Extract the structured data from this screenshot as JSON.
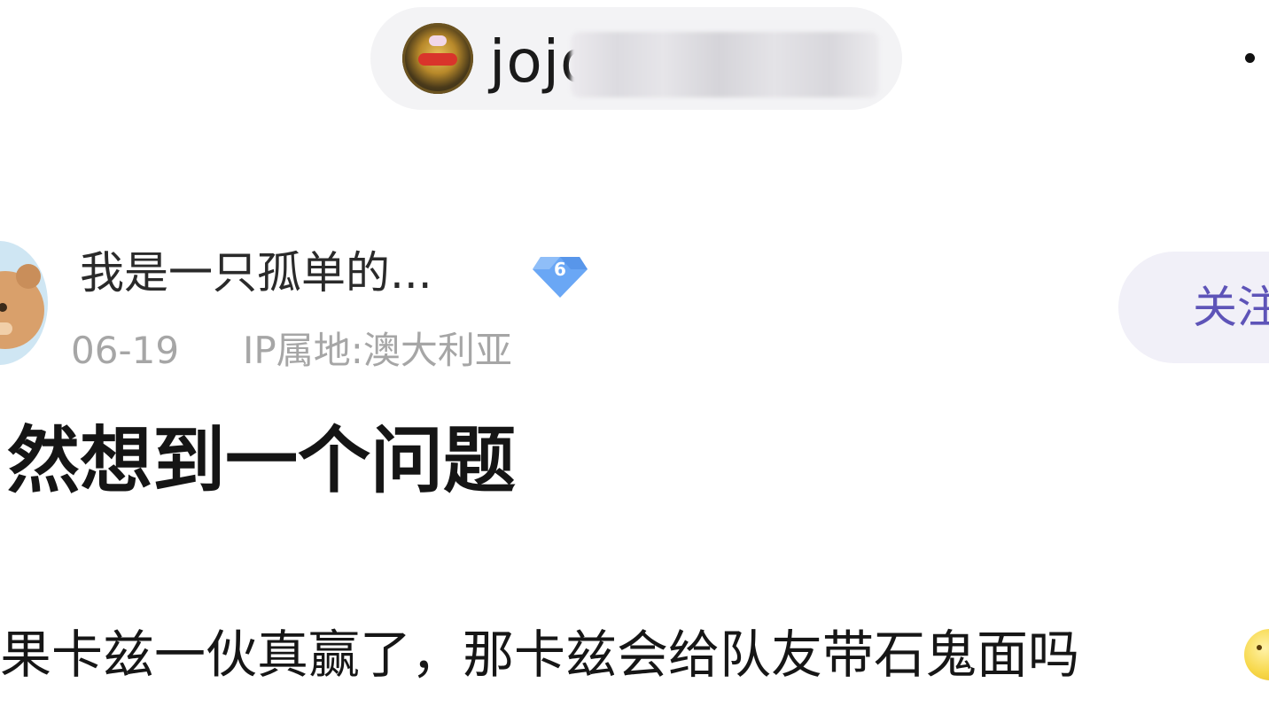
{
  "forum": {
    "name_visible": "jojo",
    "name_blurred": true,
    "avatar_icon": "forum-avatar-icon"
  },
  "header": {
    "more_icon": "more-dot-icon"
  },
  "post": {
    "author": {
      "username": "我是一只孤单的...",
      "level": "6",
      "date": "06-19",
      "ip_location": "IP属地:澳大利亚",
      "avatar_icon": "bear-avatar-icon"
    },
    "follow_label": "关注",
    "title": "然想到一个问题",
    "body": "果卡兹一伙真赢了，那卡兹会给队友带石鬼面吗",
    "emoji_icon": "smiling-face-emoji"
  },
  "colors": {
    "follow_text": "#5e54b8",
    "follow_bg": "#f1f0f8",
    "level_badge": "#6aa7f5",
    "meta_text": "#a6a6a6"
  }
}
